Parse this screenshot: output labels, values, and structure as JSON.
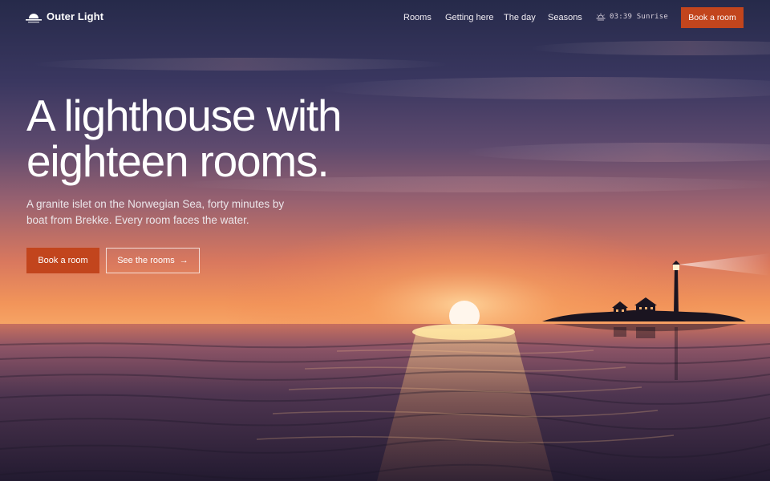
{
  "brand": {
    "name": "Outer Light",
    "logo_icon": "sun-over-horizon-icon"
  },
  "nav": {
    "items": [
      "Rooms",
      "Getting here",
      "The day",
      "Seasons"
    ]
  },
  "clock": {
    "icon": "sunrise-icon",
    "text": "03:39 Sunrise"
  },
  "header": {
    "book_label": "Book a room"
  },
  "hero": {
    "title_line1": "A lighthouse with",
    "title_line2": "eighteen rooms.",
    "subtitle": "A granite islet on the Norwegian Sea, forty minutes by boat from Brekke. Every room faces the water.",
    "primary_cta": "Book a room",
    "secondary_cta": "See the rooms",
    "secondary_icon": "arrow-right-icon"
  },
  "colors": {
    "accent": "#c2451d",
    "sky_top": "#2b2c4e",
    "horizon": "#f08a4a",
    "sea": "#2a1f38"
  }
}
